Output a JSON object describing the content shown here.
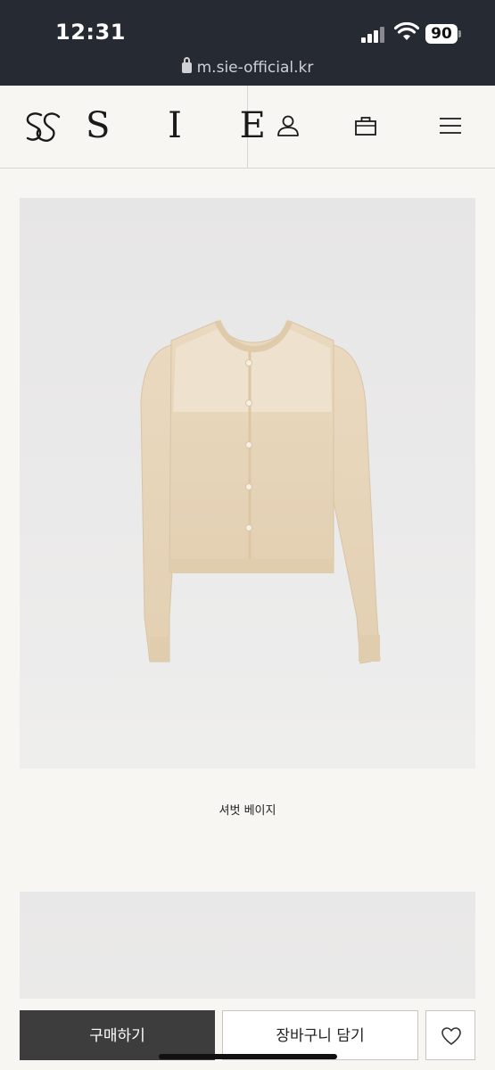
{
  "status_bar": {
    "time": "12:31",
    "battery": "90",
    "url": "m.sie-official.kr"
  },
  "header": {
    "brand": "S I E",
    "icons": [
      "user-icon",
      "bag-icon",
      "menu-icon"
    ]
  },
  "product": {
    "name": "셔벗 베이지",
    "color": "#e8d9c0"
  },
  "actions": {
    "buy_label": "구매하기",
    "cart_label": "장바구니 담기",
    "wishlist_icon": "heart-icon"
  },
  "colors": {
    "status_bar": "#262a33",
    "page_bg": "#f7f6f2",
    "buy_button": "#3d3d3d"
  }
}
